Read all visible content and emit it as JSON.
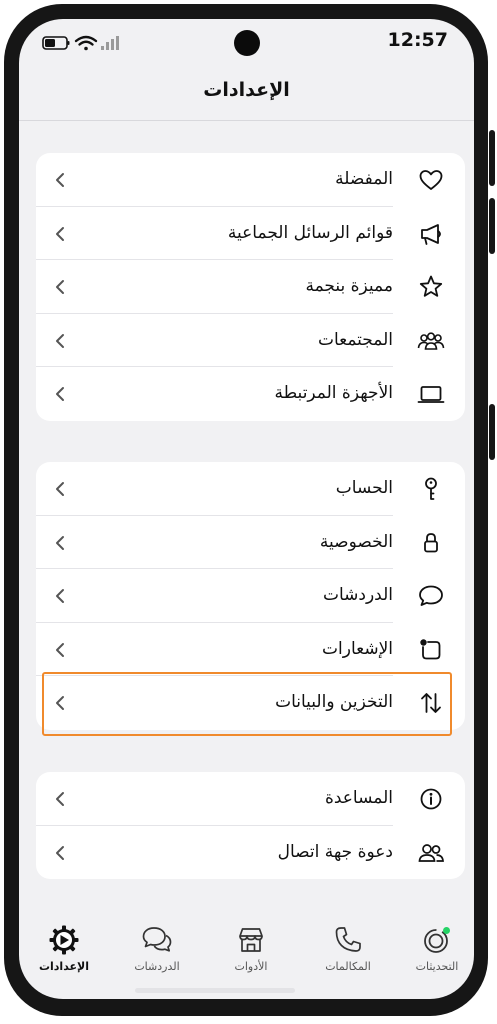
{
  "status_bar": {
    "time": "12:57"
  },
  "header": {
    "title": "الإعدادات"
  },
  "groups": [
    {
      "items": [
        {
          "label": "المفضلة",
          "icon": "heart-icon"
        },
        {
          "label": "قوائم الرسائل الجماعية",
          "icon": "megaphone-icon"
        },
        {
          "label": "مميزة بنجمة",
          "icon": "star-icon"
        },
        {
          "label": "المجتمعات",
          "icon": "communities-icon"
        },
        {
          "label": "الأجهزة المرتبطة",
          "icon": "laptop-icon"
        }
      ]
    },
    {
      "items": [
        {
          "label": "الحساب",
          "icon": "key-icon"
        },
        {
          "label": "الخصوصية",
          "icon": "lock-icon"
        },
        {
          "label": "الدردشات",
          "icon": "chat-bubble-icon"
        },
        {
          "label": "الإشعارات",
          "icon": "notification-icon"
        },
        {
          "label": "التخزين والبيانات",
          "icon": "data-arrows-icon"
        }
      ]
    },
    {
      "items": [
        {
          "label": "المساعدة",
          "icon": "info-icon"
        },
        {
          "label": "دعوة جهة اتصال",
          "icon": "people-icon"
        }
      ]
    }
  ],
  "tab_bar": {
    "tabs": [
      {
        "label": "التحديثات",
        "icon": "updates-icon"
      },
      {
        "label": "المكالمات",
        "icon": "phone-icon"
      },
      {
        "label": "الأدوات",
        "icon": "store-icon"
      },
      {
        "label": "الدردشات",
        "icon": "chats-icon"
      },
      {
        "label": "الإعدادات",
        "icon": "settings-gear-icon",
        "active": true
      }
    ]
  },
  "colors": {
    "highlight": "#f08a2c",
    "update_dot": "#25d366",
    "background": "#f1f1f3"
  }
}
